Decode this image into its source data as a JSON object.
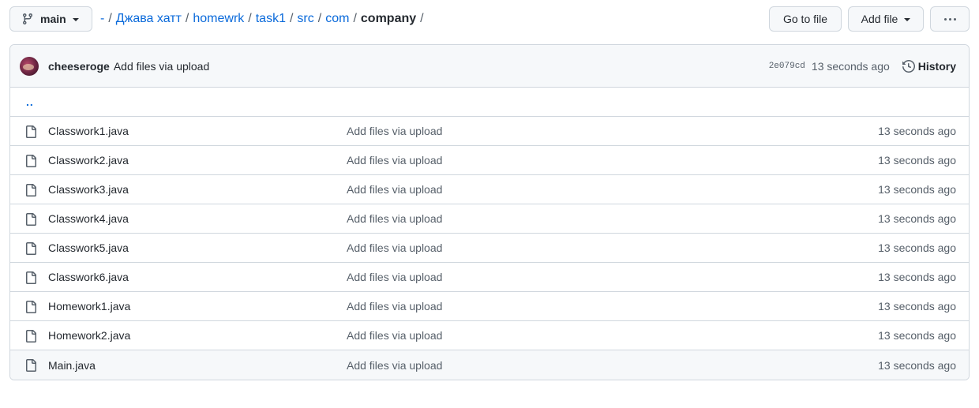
{
  "branch": {
    "label": "main",
    "icon": "git-branch-icon"
  },
  "breadcrumb": [
    {
      "label": "-",
      "link": true
    },
    {
      "label": "Джава хатт",
      "link": true
    },
    {
      "label": "homewrk",
      "link": true
    },
    {
      "label": "task1",
      "link": true
    },
    {
      "label": "src",
      "link": true
    },
    {
      "label": "com",
      "link": true
    },
    {
      "label": "company",
      "link": false
    }
  ],
  "breadcrumb_sep": "/",
  "actions": {
    "go_to_file": "Go to file",
    "add_file": "Add file"
  },
  "commit": {
    "author": "cheeseroge",
    "message": "Add files via upload",
    "sha": "2e079cd",
    "age": "13 seconds ago",
    "history_label": "History"
  },
  "parent_dir": "..",
  "files": [
    {
      "name": "Classwork1.java",
      "message": "Add files via upload",
      "age": "13 seconds ago"
    },
    {
      "name": "Classwork2.java",
      "message": "Add files via upload",
      "age": "13 seconds ago"
    },
    {
      "name": "Classwork3.java",
      "message": "Add files via upload",
      "age": "13 seconds ago"
    },
    {
      "name": "Classwork4.java",
      "message": "Add files via upload",
      "age": "13 seconds ago"
    },
    {
      "name": "Classwork5.java",
      "message": "Add files via upload",
      "age": "13 seconds ago"
    },
    {
      "name": "Classwork6.java",
      "message": "Add files via upload",
      "age": "13 seconds ago"
    },
    {
      "name": "Homework1.java",
      "message": "Add files via upload",
      "age": "13 seconds ago"
    },
    {
      "name": "Homework2.java",
      "message": "Add files via upload",
      "age": "13 seconds ago"
    },
    {
      "name": "Main.java",
      "message": "Add files via upload",
      "age": "13 seconds ago"
    }
  ],
  "colors": {
    "link": "#0969da",
    "muted": "#57606a",
    "border": "#d0d7de",
    "header_bg": "#f6f8fa"
  }
}
